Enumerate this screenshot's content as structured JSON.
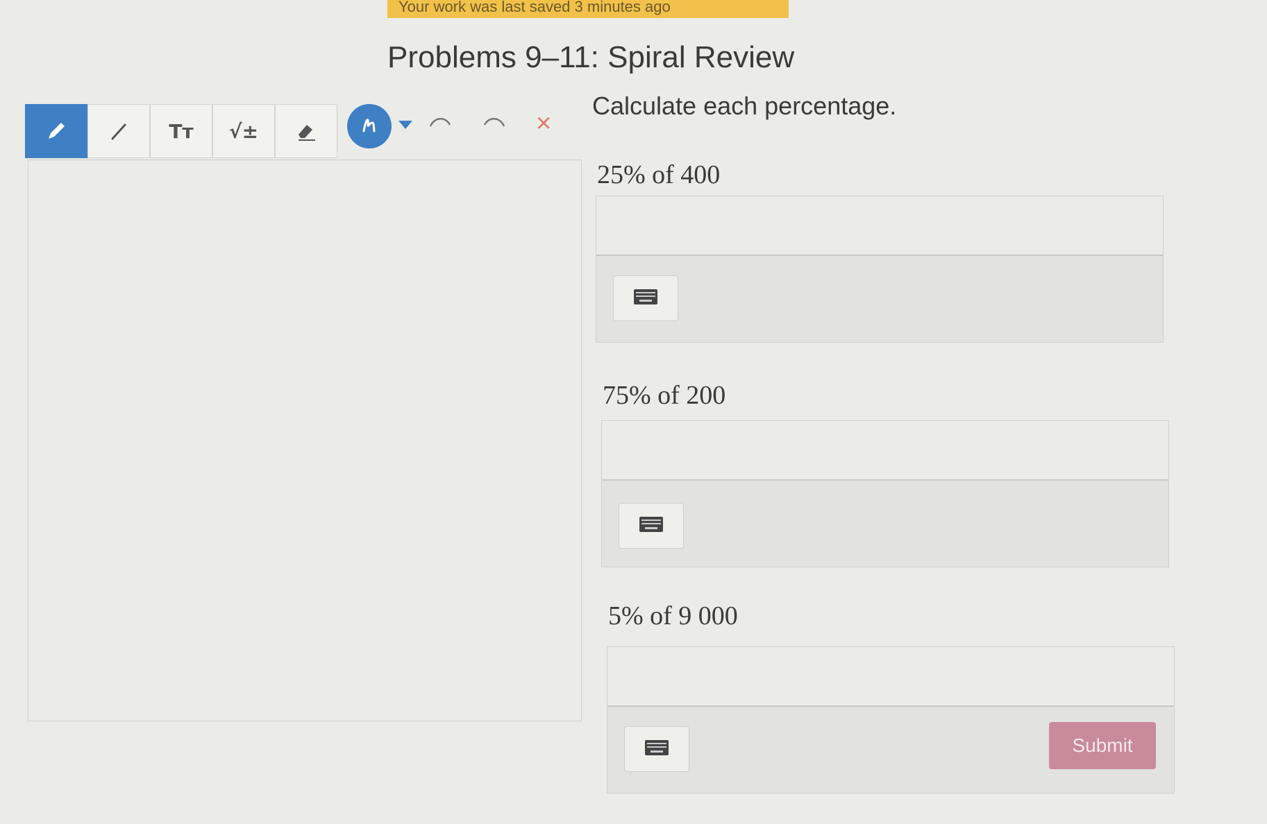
{
  "banner": {
    "text": "Your work was last saved 3 minutes ago"
  },
  "page": {
    "title": "Problems 9–11: Spiral Review"
  },
  "toolbar": {
    "text_tool_label": "Tт",
    "math_tool_label": "√±",
    "clear_label": "×"
  },
  "instructions": "Calculate each percentage.",
  "problems": [
    {
      "prompt": "25% of 400",
      "answer_value": ""
    },
    {
      "prompt": "75% of 200",
      "answer_value": ""
    },
    {
      "prompt": "5% of 9 000",
      "answer_value": ""
    }
  ],
  "submit_label": "Submit",
  "colors": {
    "accent": "#3f7fc4",
    "banner": "#f2c14a",
    "submit": "#c98a99",
    "clear_icon": "#e07a6e"
  },
  "icons": {
    "pencil": "pencil-icon",
    "line": "line-icon",
    "eraser": "eraser-icon",
    "color": "pen-color-icon",
    "undo": "undo-icon",
    "redo": "redo-icon",
    "keyboard": "keyboard-icon"
  }
}
